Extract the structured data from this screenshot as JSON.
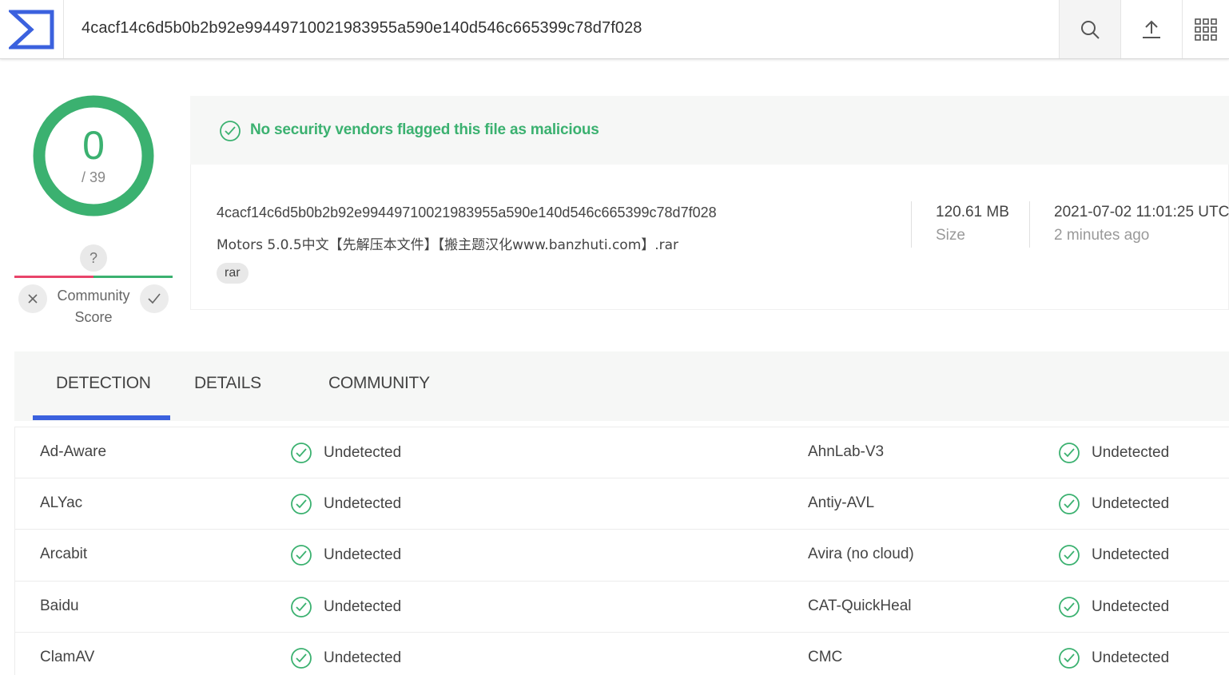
{
  "header": {
    "search_value": "4cacf14c6d5b0b2b92e99449710021983955a590e140d546c665399c78d7f028",
    "icons": {
      "logo": "virustotal-logo-icon",
      "search": "search-icon",
      "upload": "upload-icon",
      "apps": "apps-grid-icon"
    }
  },
  "score": {
    "detections": "0",
    "total": "/ 39",
    "ring_color": "#3bb170"
  },
  "community": {
    "question": "?",
    "label": "Community Score"
  },
  "summary": {
    "banner": "No security vendors flagged this file as malicious",
    "hash": "4cacf14c6d5b0b2b92e99449710021983955a590e140d546c665399c78d7f028",
    "filename": "Motors 5.0.5中文【先解压本文件】【搬主题汉化www.banzhuti.com】.rar",
    "tag": "rar",
    "size_value": "120.61 MB",
    "size_label": "Size",
    "date_value": "2021-07-02 11:01:25 UTC",
    "date_label": "2 minutes ago"
  },
  "tabs": [
    {
      "label": "DETECTION"
    },
    {
      "label": "DETAILS"
    },
    {
      "label": "COMMUNITY"
    }
  ],
  "detections": [
    {
      "left_vendor": "Ad-Aware",
      "left_result": "Undetected",
      "right_vendor": "AhnLab-V3",
      "right_result": "Undetected"
    },
    {
      "left_vendor": "ALYac",
      "left_result": "Undetected",
      "right_vendor": "Antiy-AVL",
      "right_result": "Undetected"
    },
    {
      "left_vendor": "Arcabit",
      "left_result": "Undetected",
      "right_vendor": "Avira (no cloud)",
      "right_result": "Undetected"
    },
    {
      "left_vendor": "Baidu",
      "left_result": "Undetected",
      "right_vendor": "CAT-QuickHeal",
      "right_result": "Undetected"
    },
    {
      "left_vendor": "ClamAV",
      "left_result": "Undetected",
      "right_vendor": "CMC",
      "right_result": "Undetected"
    }
  ],
  "colors": {
    "clean": "#3bb170",
    "malicious": "#e8446a",
    "accent": "#3b61de"
  }
}
